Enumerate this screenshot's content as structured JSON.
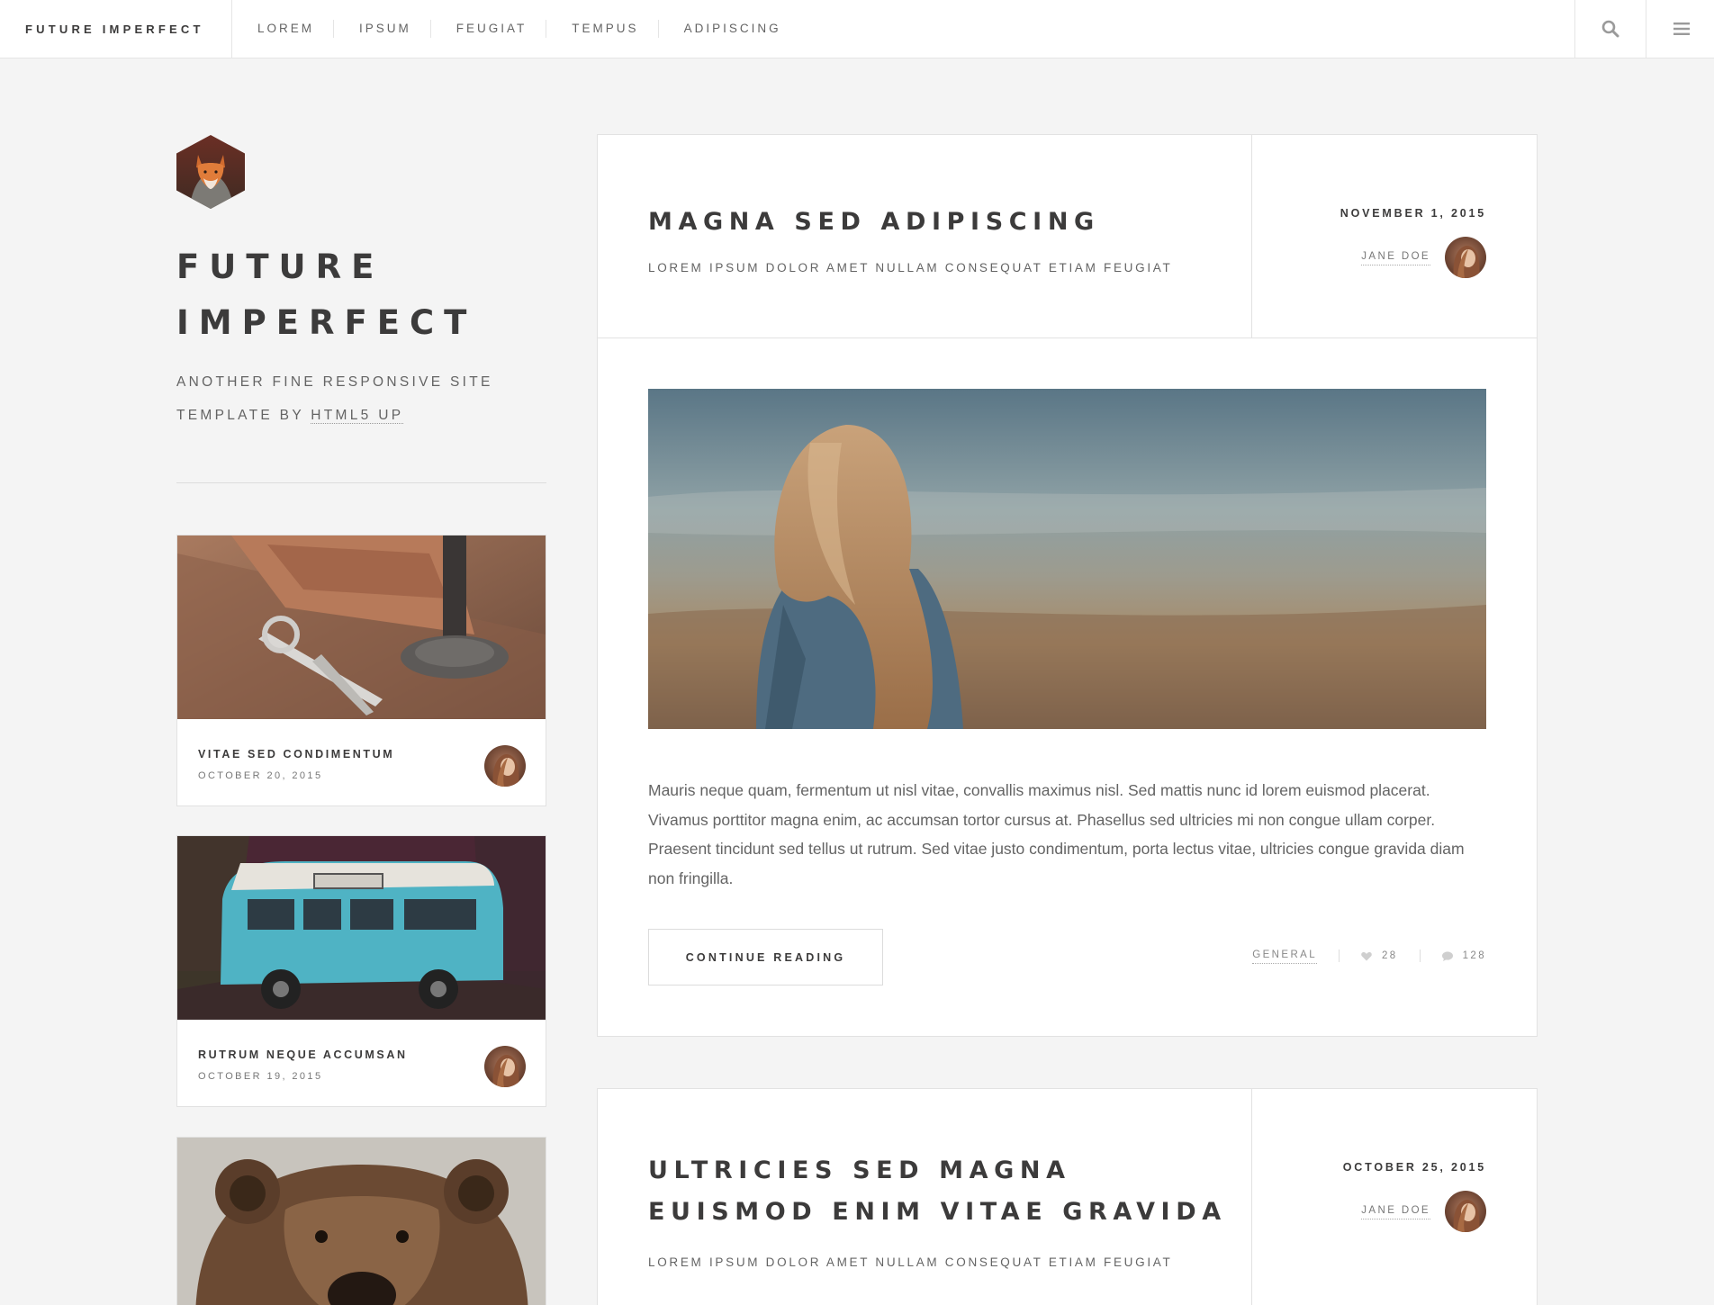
{
  "header": {
    "brand": "FUTURE IMPERFECT",
    "nav": [
      "LOREM",
      "IPSUM",
      "FEUGIAT",
      "TEMPUS",
      "ADIPISCING"
    ]
  },
  "intro": {
    "title_line1": "FUTURE",
    "title_line2": "IMPERFECT",
    "subtitle_prefix": "ANOTHER FINE RESPONSIVE SITE TEMPLATE BY ",
    "subtitle_link": "HTML5 UP"
  },
  "mini_posts": [
    {
      "title": "VITAE SED CONDIMENTUM",
      "date": "OCTOBER 20, 2015"
    },
    {
      "title": "RUTRUM NEQUE ACCUMSAN",
      "date": "OCTOBER 19, 2015"
    }
  ],
  "posts": [
    {
      "title": "MAGNA SED ADIPISCING",
      "subtitle": "LOREM IPSUM DOLOR AMET NULLAM CONSEQUAT ETIAM FEUGIAT",
      "date": "NOVEMBER 1, 2015",
      "author": "JANE DOE",
      "excerpt": "Mauris neque quam, fermentum ut nisl vitae, convallis maximus nisl. Sed mattis nunc id lorem euismod placerat. Vivamus porttitor magna enim, ac accumsan tortor cursus at. Phasellus sed ultricies mi non congue ullam corper. Praesent tincidunt sed tellus ut rutrum. Sed vitae justo condimentum, porta lectus vitae, ultricies congue gravida diam non fringilla.",
      "button": "CONTINUE READING",
      "tag": "GENERAL",
      "likes": "28",
      "comments": "128"
    },
    {
      "title_line1": "ULTRICIES SED MAGNA",
      "title_line2": "EUISMOD ENIM VITAE GRAVIDA",
      "subtitle": "LOREM IPSUM DOLOR AMET NULLAM CONSEQUAT ETIAM FEUGIAT",
      "date": "OCTOBER 25, 2015",
      "author": "JANE DOE"
    }
  ],
  "icons": {
    "search": "search-icon",
    "menu": "menu-icon",
    "heart": "heart-icon",
    "comment": "comment-icon"
  }
}
